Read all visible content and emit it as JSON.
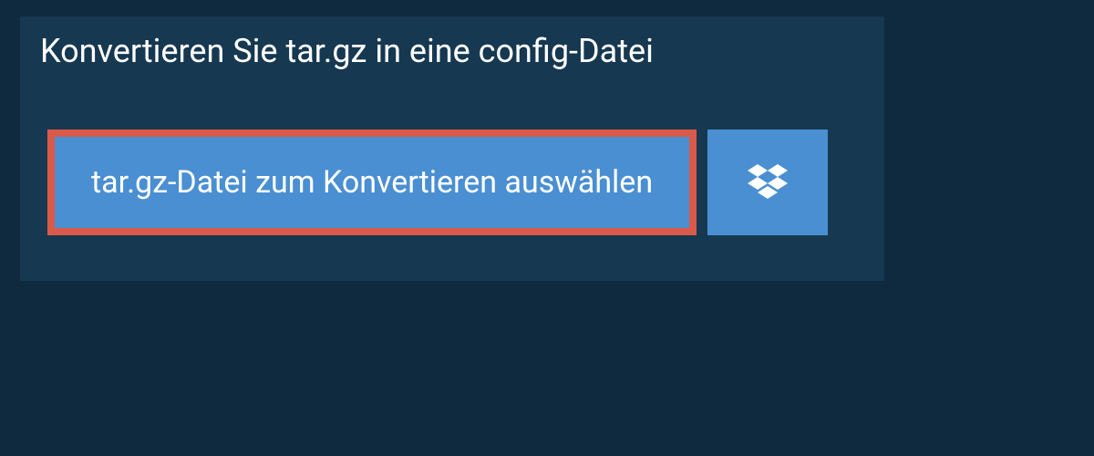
{
  "title": "Konvertieren Sie tar.gz in eine config-Datei",
  "select_button_label": "tar.gz-Datei zum Konvertieren auswählen"
}
